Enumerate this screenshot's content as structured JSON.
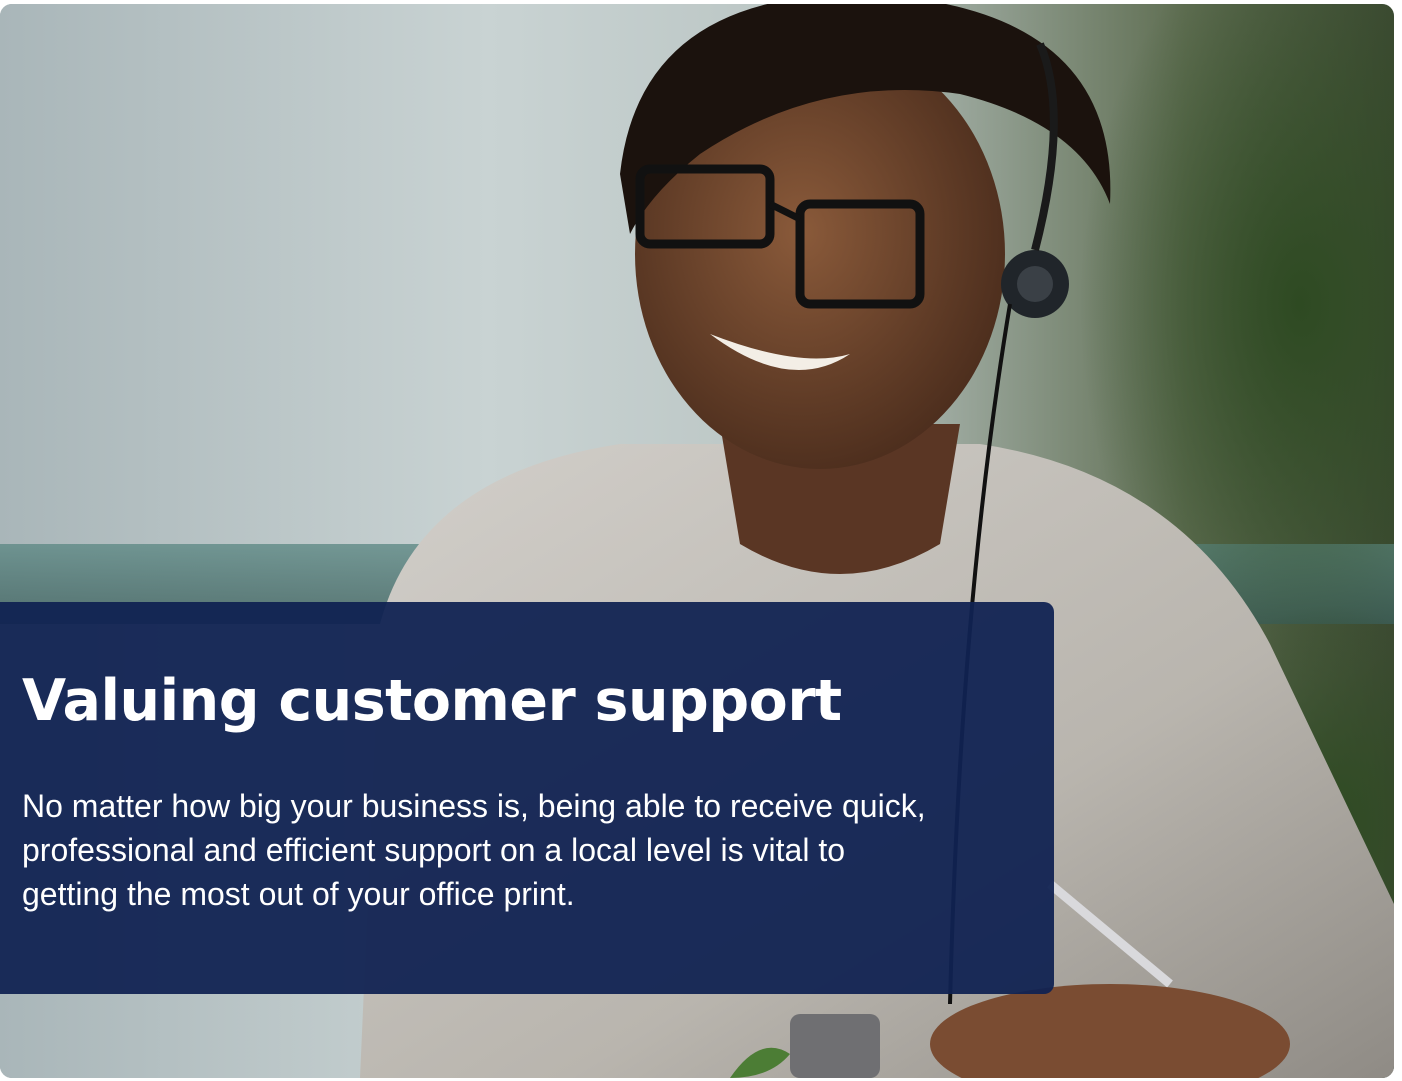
{
  "hero": {
    "title": "Valuing customer support",
    "body": "No matter how big your business is, being able to receive quick, professional and efficient support on a local level is vital to getting the most out of your office print."
  },
  "colors": {
    "overlay": "#102252",
    "text": "#ffffff"
  }
}
